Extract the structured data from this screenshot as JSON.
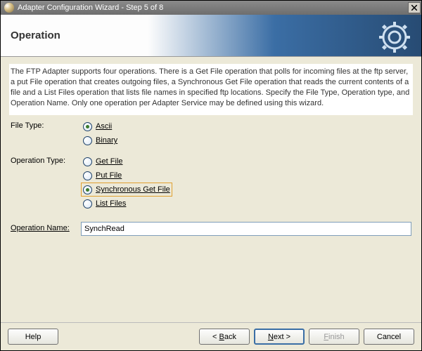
{
  "window": {
    "title": "Adapter Configuration Wizard - Step 5 of 8"
  },
  "banner": {
    "title": "Operation"
  },
  "instructions": "The FTP Adapter supports four operations.  There is a Get File operation that polls for incoming files at the ftp server, a put File operation that creates outgoing files, a Synchronous Get File operation that reads the current contents of a file and a List Files operation that lists file names in specified ftp locations.  Specify the File Type, Operation type, and Operation Name.  Only one operation per Adapter Service may be defined using this wizard.",
  "form": {
    "fileTypeLabel": "File Type:",
    "fileType": {
      "ascii": "Ascii",
      "binary": "Binary"
    },
    "operationTypeLabel": "Operation Type:",
    "operationType": {
      "getFile": "Get File",
      "putFile": "Put File",
      "syncGetFile": "Synchronous Get File",
      "listFiles": "List Files"
    },
    "operationNameLabel": "Operation Name:",
    "operationNameValue": "SynchRead"
  },
  "buttons": {
    "help": "Help",
    "back": "< Back",
    "next": "Next >",
    "finish": "Finish",
    "cancel": "Cancel"
  }
}
